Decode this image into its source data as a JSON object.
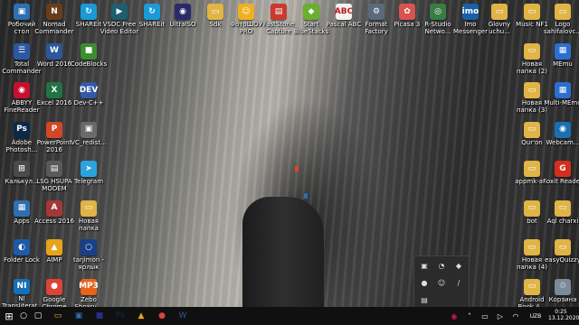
{
  "desktop": {
    "icons": [
      {
        "label": "Робочий стол",
        "glyph": "▣",
        "color": "#2f6fb0"
      },
      {
        "label": "Total Commander",
        "glyph": "☰",
        "color": "#2b57a3"
      },
      {
        "label": "ABBYY FineReader",
        "glyph": "◉",
        "color": "#c8102e"
      },
      {
        "label": "Adobe Photosh...",
        "glyph": "Ps",
        "color": "#0b2a4a"
      },
      {
        "label": "Калькул...",
        "glyph": "⊞",
        "color": "#4a4a4a"
      },
      {
        "label": "Apps",
        "glyph": "▦",
        "color": "#2f6fb0"
      },
      {
        "label": "Folder Lock",
        "glyph": "◐",
        "color": "#1e5aa8"
      },
      {
        "label": "NI Transliterat...",
        "glyph": "NI",
        "color": "#1570b8"
      },
      {
        "label": "Nomad Commander",
        "glyph": "N",
        "color": "#6a3d1a"
      },
      {
        "label": "Word 2016",
        "glyph": "W",
        "color": "#2b579a"
      },
      {
        "label": "Excel 2016",
        "glyph": "X",
        "color": "#217346"
      },
      {
        "label": "PowerPoint 2016",
        "glyph": "P",
        "color": "#d24726"
      },
      {
        "label": "LSG HSUPA MODEM",
        "glyph": "▤",
        "color": "#5a5a5a"
      },
      {
        "label": "Access 2016",
        "glyph": "A",
        "color": "#a4373a"
      },
      {
        "label": "AIMP",
        "glyph": "▲",
        "color": "#e8a21b"
      },
      {
        "label": "Google Chrome",
        "glyph": "●",
        "color": "#db4437"
      },
      {
        "label": "SHAREit",
        "glyph": "↻",
        "color": "#1a9ad6"
      },
      {
        "label": "CodeBlocks",
        "glyph": "■",
        "color": "#3c8d2f"
      },
      {
        "label": "Dev-C++",
        "glyph": "DEV",
        "color": "#3359a8"
      },
      {
        "label": "VC_redist...",
        "glyph": "▣",
        "color": "#6a6a6a"
      },
      {
        "label": "Telegram",
        "glyph": "➤",
        "color": "#2aa3de"
      },
      {
        "label": "Новая папка",
        "glyph": "▭",
        "color": "#e0b446"
      },
      {
        "label": "tarjimon - ярлык",
        "glyph": "○",
        "color": "#1a3f8a"
      },
      {
        "label": "Zebo Shoxru...",
        "glyph": "MP3",
        "color": "#e8641b"
      },
      {
        "label": "VSDC Free Video Editor",
        "glyph": "▶",
        "color": "#1e5f6e"
      },
      {
        "label": "SHAREit",
        "glyph": "↻",
        "color": "#1a9ad6"
      },
      {
        "label": "UltraISO",
        "glyph": "◉",
        "color": "#2a2a6a"
      },
      {
        "label": "Sdk",
        "glyph": "▭",
        "color": "#e0b446"
      },
      {
        "label": "ФотоШОУ PRO",
        "glyph": "☺",
        "color": "#f0b020"
      },
      {
        "label": "FastStone Capture",
        "glyph": "▤",
        "color": "#c83a2e"
      },
      {
        "label": "Start BlueStacks",
        "glyph": "◆",
        "color": "#6ab02e"
      },
      {
        "label": "Pascal ABC",
        "glyph": "ABC",
        "color": "#f2f2f2"
      },
      {
        "label": "Format Factory",
        "glyph": "⚙",
        "color": "#5a6a7a"
      },
      {
        "label": "Picasa 3",
        "glyph": "✿",
        "color": "#d9534f"
      },
      {
        "label": "R-Studio Netwo...",
        "glyph": "◎",
        "color": "#3a7d44"
      },
      {
        "label": "Imo Messenger",
        "glyph": "imo",
        "color": "#1a5fa8"
      },
      {
        "label": "Glovny uchu...",
        "glyph": "▭",
        "color": "#e0b446"
      },
      {
        "label": "Music NF1",
        "glyph": "▭",
        "color": "#e0b446"
      },
      {
        "label": "Новая папка (2)",
        "glyph": "▭",
        "color": "#e0b446"
      },
      {
        "label": "Новая папка (3)",
        "glyph": "▭",
        "color": "#e0b446"
      },
      {
        "label": "Qur'on",
        "glyph": "▭",
        "color": "#e0b446"
      },
      {
        "label": "appmk-a...",
        "glyph": "▭",
        "color": "#e0b446"
      },
      {
        "label": "bot",
        "glyph": "▭",
        "color": "#e0b446"
      },
      {
        "label": "Новая папка (4)",
        "glyph": "▭",
        "color": "#e0b446"
      },
      {
        "label": "Android Book A...",
        "glyph": "▭",
        "color": "#e0b446"
      },
      {
        "label": "Logo sahifalovc...",
        "glyph": "▭",
        "color": "#e0b446"
      },
      {
        "label": "MEmu",
        "glyph": "▦",
        "color": "#2a6fd0"
      },
      {
        "label": "Multi-MEmu",
        "glyph": "▦",
        "color": "#2a6fd0"
      },
      {
        "label": "Webcam...",
        "glyph": "◉",
        "color": "#1a6fb0"
      },
      {
        "label": "Foxit Reader",
        "glyph": "G",
        "color": "#d42e1e"
      },
      {
        "label": "Aql charxi",
        "glyph": "▭",
        "color": "#e0b446"
      },
      {
        "label": "easyQuizzy",
        "glyph": "▭",
        "color": "#e0b446"
      },
      {
        "label": "Корзина",
        "glyph": "♲",
        "color": "#7a8a9a"
      }
    ]
  },
  "tray_popup": {
    "icons": [
      {
        "name": "bluetooth-icon",
        "glyph": "▣"
      },
      {
        "name": "network-icon",
        "glyph": "◔"
      },
      {
        "name": "shield-icon",
        "glyph": "◆"
      },
      {
        "name": "user-icon",
        "glyph": "●"
      },
      {
        "name": "avatar-icon",
        "glyph": "☺"
      },
      {
        "name": "pen-icon",
        "glyph": "∕"
      },
      {
        "name": "display-icon",
        "glyph": "▤"
      }
    ]
  },
  "taskbar": {
    "start_glyph": "⊞",
    "search_glyph": "○",
    "task_view_glyph": "▢",
    "pinned": [
      {
        "name": "file-explorer-icon",
        "glyph": "▭",
        "color": "#e0b446"
      },
      {
        "name": "store-icon",
        "glyph": "▣",
        "color": "#2f6fb0"
      },
      {
        "name": "media-player-icon",
        "glyph": "■",
        "color": "#2b2b8a"
      },
      {
        "name": "photoshop-icon",
        "glyph": "Ps",
        "color": "#0b2a4a"
      },
      {
        "name": "aimp-icon",
        "glyph": "▲",
        "color": "#e8a21b"
      },
      {
        "name": "chrome-icon",
        "glyph": "●",
        "color": "#db4437"
      },
      {
        "name": "word-icon",
        "glyph": "W",
        "color": "#2b579a"
      }
    ],
    "tray": [
      {
        "name": "recording-icon",
        "glyph": "◉",
        "color": "#d4145a"
      },
      {
        "name": "up-arrow-icon",
        "glyph": "˄",
        "color": "#ffffff"
      },
      {
        "name": "battery-icon",
        "glyph": "▭",
        "color": "#ffffff"
      },
      {
        "name": "speaker-icon",
        "glyph": "▷",
        "color": "#ffffff"
      },
      {
        "name": "wifi-icon",
        "glyph": "◠",
        "color": "#ffffff"
      }
    ],
    "lang": "UZB",
    "time": "0:25",
    "date": "13.12.2020"
  }
}
